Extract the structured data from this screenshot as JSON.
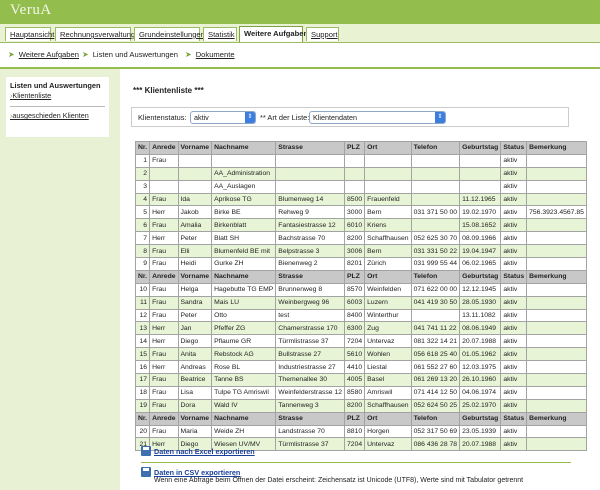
{
  "app": {
    "logo": "VeruA"
  },
  "tabs": [
    {
      "label": "Hauptansicht"
    },
    {
      "label": "Rechnungsverwaltung"
    },
    {
      "label": "Grundeinstellungen"
    },
    {
      "label": "Statistik"
    },
    {
      "label": "Weitere Aufgaben"
    },
    {
      "label": "Support"
    }
  ],
  "subnav": [
    {
      "label": "Weitere Aufgaben"
    },
    {
      "label": "Listen und Auswertungen"
    },
    {
      "label": "Dokumente"
    }
  ],
  "sidebar": {
    "heading": "Listen und Auswertungen",
    "items": [
      {
        "label": "Klientenliste"
      },
      {
        "label": "ausgeschieden Klienten"
      }
    ]
  },
  "main": {
    "title": "*** Klientenliste ***",
    "status_label": "Klientenstatus:",
    "status_value": "aktiv",
    "art_label": "** Art der Liste:",
    "art_value": "Klientendaten"
  },
  "table": {
    "headers": [
      "Nr.",
      "Anrede",
      "Vorname",
      "Nachname",
      "Strasse",
      "PLZ",
      "Ort",
      "Telefon",
      "Geburtstag",
      "Status",
      "Bemerkung"
    ],
    "rows": [
      {
        "header": false,
        "cells": [
          "1",
          "Frau",
          "",
          "",
          "",
          "",
          "",
          "",
          "",
          "aktiv",
          ""
        ]
      },
      {
        "header": false,
        "cells": [
          "2",
          "",
          "",
          "AA_Administration",
          "",
          "",
          "",
          "",
          "",
          "aktiv",
          ""
        ]
      },
      {
        "header": false,
        "cells": [
          "3",
          "",
          "",
          "AA_Auslagen",
          "",
          "",
          "",
          "",
          "",
          "aktiv",
          ""
        ]
      },
      {
        "header": false,
        "cells": [
          "4",
          "Frau",
          "Ida",
          "Aprikose TG",
          "Blumenweg 14",
          "8500",
          "Frauenfeld",
          "",
          "11.12.1965",
          "aktiv",
          ""
        ]
      },
      {
        "header": false,
        "cells": [
          "5",
          "Herr",
          "Jakob",
          "Birke BE",
          "Rehweg 9",
          "3000",
          "Bern",
          "031 371 50 00",
          "19.02.1970",
          "aktiv",
          "756.3923.4567.85"
        ]
      },
      {
        "header": false,
        "cells": [
          "6",
          "Frau",
          "Amalia",
          "Birkenblatt",
          "Fantasiestrasse 12",
          "6010",
          "Kriens",
          "",
          "15.08.1652",
          "aktiv",
          ""
        ]
      },
      {
        "header": false,
        "cells": [
          "7",
          "Herr",
          "Peter",
          "Blatt SH",
          "Bachstrasse 70",
          "8200",
          "Schaffhausen",
          "052 625 30 70",
          "08.09.1966",
          "aktiv",
          ""
        ]
      },
      {
        "header": false,
        "cells": [
          "8",
          "Frau",
          "Elli",
          "Blumenfeld BE mit",
          "Belpstrasse 3",
          "3006",
          "Bern",
          "031 331 50 22",
          "19.04.1947",
          "aktiv",
          ""
        ]
      },
      {
        "header": false,
        "cells": [
          "9",
          "Frau",
          "Heidi",
          "Gurke ZH",
          "Bienenweg 2",
          "8201",
          "Zürich",
          "031 999 55 44",
          "06.02.1965",
          "aktiv",
          ""
        ]
      },
      {
        "header": true,
        "cells": [
          "Nr.",
          "Anrede",
          "Vorname",
          "Nachname",
          "Strasse",
          "PLZ",
          "Ort",
          "Telefon",
          "Geburtstag",
          "Status",
          "Bemerkung"
        ]
      },
      {
        "header": false,
        "cells": [
          "10",
          "Frau",
          "Helga",
          "Hagebutte TG EMP",
          "Brunnenweg 8",
          "8570",
          "Weinfelden",
          "071 622 00 00",
          "12.12.1945",
          "aktiv",
          ""
        ]
      },
      {
        "header": false,
        "cells": [
          "11",
          "Frau",
          "Sandra",
          "Mais LU",
          "Weinbergweg 96",
          "6003",
          "Luzern",
          "041 419 30 50",
          "28.05.1930",
          "aktiv",
          ""
        ]
      },
      {
        "header": false,
        "cells": [
          "12",
          "Frau",
          "Peter",
          "Otto",
          "test",
          "8400",
          "Winterthur",
          "",
          "13.11.1082",
          "aktiv",
          ""
        ]
      },
      {
        "header": false,
        "cells": [
          "13",
          "Herr",
          "Jan",
          "Pfeffer ZG",
          "Chamerstrasse 170",
          "6300",
          "Zug",
          "041 741 11 22",
          "08.06.1949",
          "aktiv",
          ""
        ]
      },
      {
        "header": false,
        "cells": [
          "14",
          "Herr",
          "Diego",
          "Pflaume GR",
          "Türmlistrasse 37",
          "7204",
          "Untervaz",
          "081 322 14 21",
          "20.07.1988",
          "aktiv",
          ""
        ]
      },
      {
        "header": false,
        "cells": [
          "15",
          "Frau",
          "Anita",
          "Rebstock AG",
          "Bullstrasse 27",
          "5610",
          "Wohlen",
          "056 618 25 40",
          "01.05.1962",
          "aktiv",
          ""
        ]
      },
      {
        "header": false,
        "cells": [
          "16",
          "Herr",
          "Andreas",
          "Rose BL",
          "Industriestrasse 27",
          "4410",
          "Liestal",
          "061 552 27 60",
          "12.03.1975",
          "aktiv",
          ""
        ]
      },
      {
        "header": false,
        "cells": [
          "17",
          "Frau",
          "Beatrice",
          "Tanne BS",
          "Themenallee 30",
          "4005",
          "Basel",
          "061 269 13 20",
          "26.10.1960",
          "aktiv",
          ""
        ]
      },
      {
        "header": false,
        "cells": [
          "18",
          "Frau",
          "Lisa",
          "Tulpe TG Amriswil",
          "Weinfelderstrasse 12",
          "8580",
          "Amriswil",
          "071 414 12 50",
          "04.06.1974",
          "aktiv",
          ""
        ]
      },
      {
        "header": false,
        "cells": [
          "19",
          "Frau",
          "Dora",
          "Wald IV",
          "Tannenweg 3",
          "8200",
          "Schaffhausen",
          "052 624 50 25",
          "25.02.1970",
          "aktiv",
          ""
        ]
      },
      {
        "header": true,
        "cells": [
          "Nr.",
          "Anrede",
          "Vorname",
          "Nachname",
          "Strasse",
          "PLZ",
          "Ort",
          "Telefon",
          "Geburtstag",
          "Status",
          "Bemerkung"
        ]
      },
      {
        "header": false,
        "cells": [
          "20",
          "Frau",
          "Maria",
          "Weide ZH",
          "Landstrasse 70",
          "8810",
          "Horgen",
          "052 317 50 69",
          "23.05.1939",
          "aktiv",
          ""
        ]
      },
      {
        "header": false,
        "cells": [
          "21",
          "Herr",
          "Diego",
          "Wiesen UV/MV",
          "Türmlistrasse 37",
          "7204",
          "Untervaz",
          "086 436 28 78",
          "20.07.1988",
          "aktiv",
          ""
        ]
      }
    ]
  },
  "exports": {
    "excel_label": "Daten nach Excel exportieren",
    "csv_label": "Daten in CSV exportieren",
    "csv_note": "Wenn eine Abfrage beim Öffnen der Datei erscheint: Zeichensatz ist Unicode (UTF8), Werte sind mit Tabulator getrennt"
  }
}
